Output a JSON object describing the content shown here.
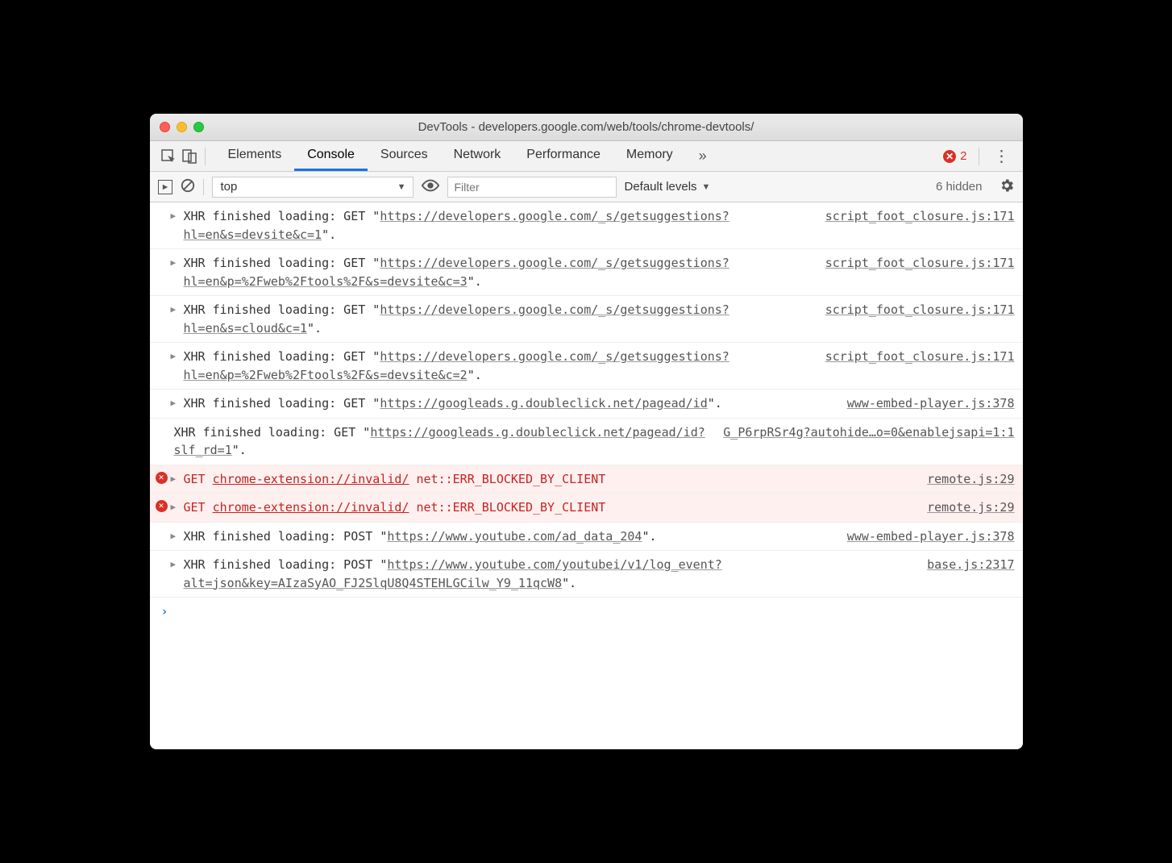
{
  "window": {
    "title": "DevTools - developers.google.com/web/tools/chrome-devtools/"
  },
  "tabs": {
    "items": [
      "Elements",
      "Console",
      "Sources",
      "Network",
      "Performance",
      "Memory"
    ],
    "active": "Console",
    "overflow_glyph": "»",
    "error_count": "2"
  },
  "filter": {
    "context": "top",
    "filter_placeholder": "Filter",
    "levels_label": "Default levels",
    "hidden_label": "6 hidden"
  },
  "logs": [
    {
      "type": "xhr",
      "disclose": true,
      "prefix": "XHR finished loading: GET \"",
      "url": "https://developers.google.com/_s/getsuggestions?hl=en&s=devsite&c=1",
      "suffix": "\".",
      "source": "script_foot_closure.js:171"
    },
    {
      "type": "xhr",
      "disclose": true,
      "prefix": "XHR finished loading: GET \"",
      "url": "https://developers.google.com/_s/getsuggestions?hl=en&p=%2Fweb%2Ftools%2F&s=devsite&c=3",
      "suffix": "\".",
      "source": "script_foot_closure.js:171"
    },
    {
      "type": "xhr",
      "disclose": true,
      "prefix": "XHR finished loading: GET \"",
      "url": "https://developers.google.com/_s/getsuggestions?hl=en&s=cloud&c=1",
      "suffix": "\".",
      "source": "script_foot_closure.js:171"
    },
    {
      "type": "xhr",
      "disclose": true,
      "prefix": "XHR finished loading: GET \"",
      "url": "https://developers.google.com/_s/getsuggestions?hl=en&p=%2Fweb%2Ftools%2F&s=devsite&c=2",
      "suffix": "\".",
      "source": "script_foot_closure.js:171"
    },
    {
      "type": "xhr",
      "disclose": true,
      "prefix": "XHR finished loading: GET \"",
      "url": "https://googleads.g.doubleclick.net/pagead/id",
      "suffix": "\".",
      "source": "www-embed-player.js:378"
    },
    {
      "type": "xhr",
      "disclose": false,
      "prefix": "XHR finished loading: GET \"",
      "url": "https://googleads.g.doubleclick.net/pagead/id?slf_rd=1",
      "suffix": "\".",
      "source": "G_P6rpRSr4g?autohide…o=0&enablejsapi=1:1"
    },
    {
      "type": "error",
      "disclose": true,
      "method": "GET",
      "url": "chrome-extension://invalid/",
      "error_text": "net::ERR_BLOCKED_BY_CLIENT",
      "source": "remote.js:29"
    },
    {
      "type": "error",
      "disclose": true,
      "method": "GET",
      "url": "chrome-extension://invalid/",
      "error_text": "net::ERR_BLOCKED_BY_CLIENT",
      "source": "remote.js:29"
    },
    {
      "type": "xhr",
      "disclose": true,
      "prefix": "XHR finished loading: POST \"",
      "url": "https://www.youtube.com/ad_data_204",
      "suffix": "\".",
      "source": "www-embed-player.js:378"
    },
    {
      "type": "xhr",
      "disclose": true,
      "prefix": "XHR finished loading: POST \"",
      "url": "https://www.youtube.com/youtubei/v1/log_event?alt=json&key=AIzaSyAO_FJ2SlqU8Q4STEHLGCilw_Y9_11qcW8",
      "suffix": "\".",
      "source": "base.js:2317"
    }
  ]
}
